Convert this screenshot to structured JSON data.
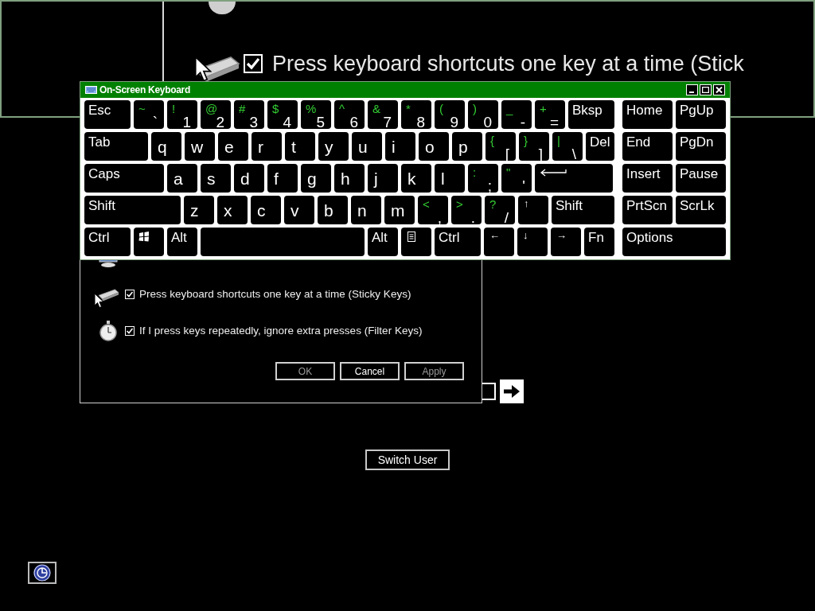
{
  "magnifier": {
    "option": {
      "label": "Press keyboard shortcuts one key at a time (Stick",
      "checked": true
    }
  },
  "dialog": {
    "options": [
      {
        "label": "Press keyboard shortcuts one key at a time (Sticky Keys)",
        "checked": true
      },
      {
        "label": "If I press keys repeatedly, ignore extra presses (Filter Keys)",
        "checked": true
      }
    ],
    "buttons": [
      {
        "label": "OK",
        "disabled": true
      },
      {
        "label": "Cancel",
        "disabled": false
      },
      {
        "label": "Apply",
        "disabled": true
      }
    ]
  },
  "logon": {
    "switch_user": "Switch User"
  },
  "keyboard": {
    "title": "On-Screen Keyboard",
    "main_rows": [
      [
        {
          "kind": "named",
          "label": "Esc"
        },
        {
          "kind": "dual",
          "shift": "~",
          "label": "`"
        },
        {
          "kind": "dual",
          "shift": "!",
          "label": "1"
        },
        {
          "kind": "dual",
          "shift": "@",
          "label": "2"
        },
        {
          "kind": "dual",
          "shift": "#",
          "label": "3"
        },
        {
          "kind": "dual",
          "shift": "$",
          "label": "4"
        },
        {
          "kind": "dual",
          "shift": "%",
          "label": "5"
        },
        {
          "kind": "dual",
          "shift": "^",
          "label": "6"
        },
        {
          "kind": "dual",
          "shift": "&",
          "label": "7"
        },
        {
          "kind": "dual",
          "shift": "*",
          "label": "8"
        },
        {
          "kind": "dual",
          "shift": "(",
          "label": "9"
        },
        {
          "kind": "dual",
          "shift": ")",
          "label": "0"
        },
        {
          "kind": "dual",
          "shift": "_",
          "label": "-"
        },
        {
          "kind": "dual",
          "shift": "+",
          "label": "="
        },
        {
          "kind": "named",
          "label": "Bksp"
        }
      ],
      [
        {
          "kind": "named",
          "label": "Tab"
        },
        {
          "kind": "letter",
          "label": "q"
        },
        {
          "kind": "letter",
          "label": "w"
        },
        {
          "kind": "letter",
          "label": "e"
        },
        {
          "kind": "letter",
          "label": "r"
        },
        {
          "kind": "letter",
          "label": "t"
        },
        {
          "kind": "letter",
          "label": "y"
        },
        {
          "kind": "letter",
          "label": "u"
        },
        {
          "kind": "letter",
          "label": "i"
        },
        {
          "kind": "letter",
          "label": "o"
        },
        {
          "kind": "letter",
          "label": "p"
        },
        {
          "kind": "dual",
          "shift": "{",
          "label": "["
        },
        {
          "kind": "dual",
          "shift": "}",
          "label": "]"
        },
        {
          "kind": "dual",
          "shift": "|",
          "label": "\\"
        },
        {
          "kind": "named",
          "label": "Del"
        }
      ],
      [
        {
          "kind": "named",
          "label": "Caps"
        },
        {
          "kind": "letter",
          "label": "a"
        },
        {
          "kind": "letter",
          "label": "s"
        },
        {
          "kind": "letter",
          "label": "d"
        },
        {
          "kind": "letter",
          "label": "f"
        },
        {
          "kind": "letter",
          "label": "g"
        },
        {
          "kind": "letter",
          "label": "h"
        },
        {
          "kind": "letter",
          "label": "j"
        },
        {
          "kind": "letter",
          "label": "k"
        },
        {
          "kind": "letter",
          "label": "l"
        },
        {
          "kind": "dual",
          "shift": ":",
          "label": ";"
        },
        {
          "kind": "dual",
          "shift": "\"",
          "label": "'"
        },
        {
          "kind": "enter"
        }
      ],
      [
        {
          "kind": "named",
          "label": "Shift"
        },
        {
          "kind": "letter",
          "label": "z"
        },
        {
          "kind": "letter",
          "label": "x"
        },
        {
          "kind": "letter",
          "label": "c"
        },
        {
          "kind": "letter",
          "label": "v"
        },
        {
          "kind": "letter",
          "label": "b"
        },
        {
          "kind": "letter",
          "label": "n"
        },
        {
          "kind": "letter",
          "label": "m"
        },
        {
          "kind": "dual",
          "shift": "<",
          "label": ","
        },
        {
          "kind": "dual",
          "shift": ">",
          "label": "."
        },
        {
          "kind": "dual",
          "shift": "?",
          "label": "/"
        },
        {
          "kind": "arrow",
          "label": "↑"
        },
        {
          "kind": "named",
          "label": "Shift"
        }
      ],
      [
        {
          "kind": "named",
          "label": "Ctrl"
        },
        {
          "kind": "windows"
        },
        {
          "kind": "named",
          "label": "Alt"
        },
        {
          "kind": "space"
        },
        {
          "kind": "named",
          "label": "Alt"
        },
        {
          "kind": "menu"
        },
        {
          "kind": "named",
          "label": "Ctrl"
        },
        {
          "kind": "arrow",
          "label": "←"
        },
        {
          "kind": "arrow",
          "label": "↓"
        },
        {
          "kind": "arrow",
          "label": "→"
        },
        {
          "kind": "named",
          "label": "Fn"
        }
      ]
    ],
    "side_rows": [
      [
        {
          "kind": "named",
          "label": "Home"
        },
        {
          "kind": "named",
          "label": "PgUp"
        }
      ],
      [
        {
          "kind": "named",
          "label": "End"
        },
        {
          "kind": "named",
          "label": "PgDn"
        }
      ],
      [
        {
          "kind": "named",
          "label": "Insert"
        },
        {
          "kind": "named",
          "label": "Pause"
        }
      ],
      [
        {
          "kind": "named",
          "label": "PrtScn"
        },
        {
          "kind": "named",
          "label": "ScrLk"
        }
      ],
      [
        {
          "kind": "named",
          "label": "Options"
        }
      ]
    ]
  }
}
